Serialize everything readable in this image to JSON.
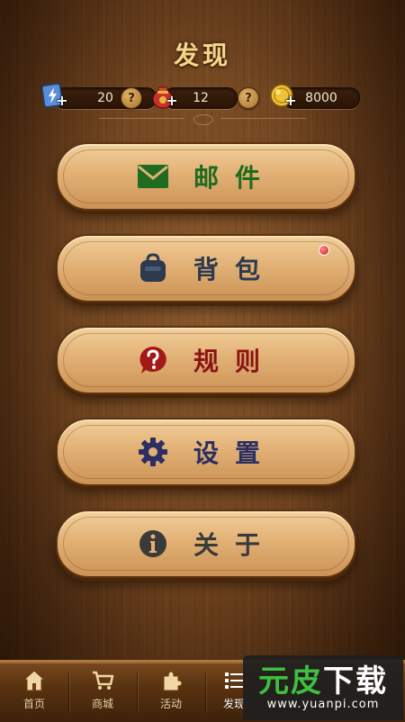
{
  "page": {
    "title": "发现"
  },
  "resources": {
    "energy": {
      "value": "20",
      "icon": "energy-card-icon",
      "help": "?"
    },
    "bag": {
      "value": "12",
      "icon": "lucky-bag-icon",
      "help": "?"
    },
    "coins": {
      "value": "8000",
      "icon": "gold-coin-icon"
    },
    "plus": "+"
  },
  "menu": {
    "mail": {
      "label": "邮件",
      "icon": "mail-icon",
      "color": "#1f6b1f"
    },
    "backpack": {
      "label": "背包",
      "icon": "backpack-icon",
      "color": "#2d3a4e"
    },
    "rules": {
      "label": "规则",
      "icon": "help-bubble-icon",
      "color": "#8a1414"
    },
    "settings": {
      "label": "设置",
      "icon": "gear-icon",
      "color": "#2c2f63"
    },
    "about": {
      "label": "关于",
      "icon": "info-icon",
      "color": "#3a3a3a"
    }
  },
  "tabbar": {
    "tabs": [
      {
        "label": "首页",
        "icon": "home-icon"
      },
      {
        "label": "商城",
        "icon": "cart-icon"
      },
      {
        "label": "活动",
        "icon": "puzzle-icon"
      },
      {
        "label": "发现",
        "icon": "list-icon"
      }
    ]
  },
  "watermark": {
    "brand_part1": "元皮",
    "brand_part2": "下载",
    "url": "www.yuanpi.com"
  }
}
